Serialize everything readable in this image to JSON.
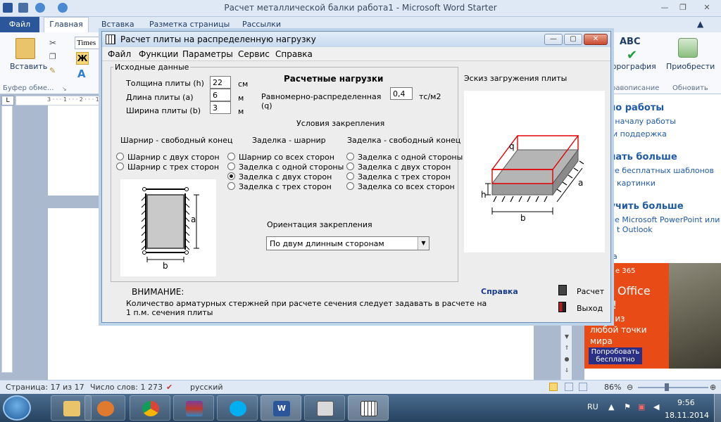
{
  "word": {
    "title": "Расчет металлической балки работа1  -  Microsoft Word Starter",
    "tabs": {
      "file": "Файл",
      "home": "Главная",
      "insert": "Вставка",
      "layout": "Разметка страницы",
      "mailings": "Рассылки"
    },
    "ribbon": {
      "paste": "Вставить",
      "clipboard_group": "Буфер обме...",
      "font_name": "Times N",
      "bold": "Ж",
      "spelling_icon_text": "ABC",
      "spelling": "фрография",
      "spelling_group": "равописание",
      "addins": "Приобрести",
      "update_group": "Обновить"
    },
    "ruler_marks": "3 · · · 1 · · · 2 · · · 1",
    "ruler_corner": "L",
    "side": {
      "h1": "ало работы",
      "l1": "по началу работы",
      "l2": "и поддержка",
      "h2": "елать больше",
      "l3": "ие бесплатных шаблонов",
      "l4": "картинки",
      "h3": "лучить больше",
      "l5": "ие Microsoft PowerPoint или",
      "l6": "t Outlook",
      "l7": "а"
    },
    "ad": {
      "brand": "e 365",
      "line1": "ьми Office",
      "line2": "бой!",
      "line3": "айте из",
      "line4": "любой точки",
      "line5": "мира",
      "button": "Попробовать бесплатно"
    },
    "status": {
      "page": "Страница: 17 из 17",
      "words": "Число слов: 1 273",
      "lang": "русский",
      "zoom": "86%"
    }
  },
  "taskbar": {
    "lang": "RU",
    "time": "9:56",
    "date": "18.11.2014",
    "word_letter": "W"
  },
  "dialog": {
    "title": "Расчет плиты на распределенную нагрузку",
    "menu": [
      "Файл",
      "Функции",
      "Параметры",
      "Сервис",
      "Справка"
    ],
    "controls": {
      "minimize": "—",
      "maximize": "▢",
      "close": "✕"
    },
    "group_label": "Исходные данные",
    "thickness_label": "Толщина плиты (h)",
    "thickness_value": "22",
    "thickness_unit": "см",
    "length_label": "Длина плиты (a)",
    "length_value": "6",
    "length_unit": "м",
    "width_label": "Ширина плиты (b)",
    "width_value": "3",
    "width_unit": "м",
    "loads_title": "Расчетные нагрузки",
    "load_label_1": "Равномерно-распределенная",
    "load_label_2": "(q)",
    "load_value": "0,4",
    "load_unit": "тс/м2",
    "conditions_title": "Условия закрепления",
    "col1_title": "Шарнир - свободный конец",
    "col2_title": "Заделка - шарнир",
    "col3_title": "Заделка - свободный конец",
    "col1": [
      "Шарнир с двух сторон",
      "Шарнир с трех сторон"
    ],
    "col2": [
      "Шарнир со всех сторон",
      "Заделка с одной стороны",
      "Заделка с двух сторон",
      "Заделка с трех сторон"
    ],
    "col3": [
      "Заделка с одной стороны",
      "Заделка с двух сторон",
      "Заделка с трех сторон",
      "Заделка со всех сторон"
    ],
    "col2_selected": "Заделка с двух сторон",
    "orientation_title": "Ориентация закрепления",
    "orientation_value": "По двум длинным сторонам",
    "sketch_title": "Эскиз загружения плиты",
    "sketch_small_labels": {
      "a": "a",
      "b": "b"
    },
    "sketch_big_labels": {
      "q": "q",
      "a": "a",
      "b": "b",
      "h": "h"
    },
    "warning_title": "ВНИМАНИЕ:",
    "warning_text_1": "Количество арматурных стержней при расчете сечения следует задавать в расчете на",
    "warning_text_2": "1 п.м. сечения плиты",
    "help_link": "Справка",
    "calc_button": "Расчет",
    "exit_button": "Выход"
  }
}
